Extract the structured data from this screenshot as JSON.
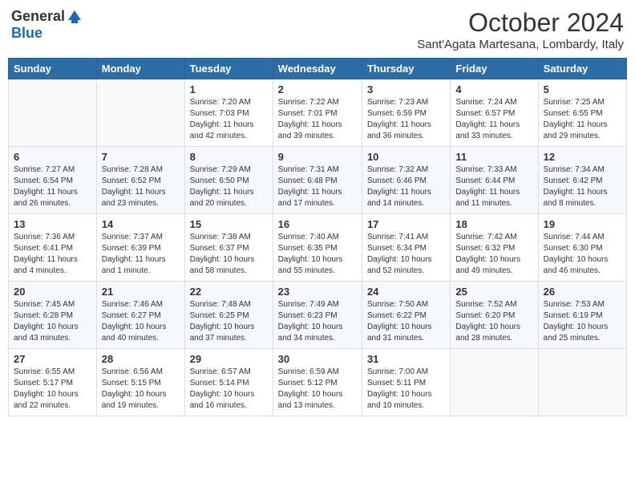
{
  "header": {
    "logo_general": "General",
    "logo_blue": "Blue",
    "month_title": "October 2024",
    "location": "Sant'Agata Martesana, Lombardy, Italy"
  },
  "days_of_week": [
    "Sunday",
    "Monday",
    "Tuesday",
    "Wednesday",
    "Thursday",
    "Friday",
    "Saturday"
  ],
  "weeks": [
    [
      {
        "day": "",
        "info": ""
      },
      {
        "day": "",
        "info": ""
      },
      {
        "day": "1",
        "info": "Sunrise: 7:20 AM\nSunset: 7:03 PM\nDaylight: 11 hours and 42 minutes."
      },
      {
        "day": "2",
        "info": "Sunrise: 7:22 AM\nSunset: 7:01 PM\nDaylight: 11 hours and 39 minutes."
      },
      {
        "day": "3",
        "info": "Sunrise: 7:23 AM\nSunset: 6:59 PM\nDaylight: 11 hours and 36 minutes."
      },
      {
        "day": "4",
        "info": "Sunrise: 7:24 AM\nSunset: 6:57 PM\nDaylight: 11 hours and 33 minutes."
      },
      {
        "day": "5",
        "info": "Sunrise: 7:25 AM\nSunset: 6:55 PM\nDaylight: 11 hours and 29 minutes."
      }
    ],
    [
      {
        "day": "6",
        "info": "Sunrise: 7:27 AM\nSunset: 6:54 PM\nDaylight: 11 hours and 26 minutes."
      },
      {
        "day": "7",
        "info": "Sunrise: 7:28 AM\nSunset: 6:52 PM\nDaylight: 11 hours and 23 minutes."
      },
      {
        "day": "8",
        "info": "Sunrise: 7:29 AM\nSunset: 6:50 PM\nDaylight: 11 hours and 20 minutes."
      },
      {
        "day": "9",
        "info": "Sunrise: 7:31 AM\nSunset: 6:48 PM\nDaylight: 11 hours and 17 minutes."
      },
      {
        "day": "10",
        "info": "Sunrise: 7:32 AM\nSunset: 6:46 PM\nDaylight: 11 hours and 14 minutes."
      },
      {
        "day": "11",
        "info": "Sunrise: 7:33 AM\nSunset: 6:44 PM\nDaylight: 11 hours and 11 minutes."
      },
      {
        "day": "12",
        "info": "Sunrise: 7:34 AM\nSunset: 6:42 PM\nDaylight: 11 hours and 8 minutes."
      }
    ],
    [
      {
        "day": "13",
        "info": "Sunrise: 7:36 AM\nSunset: 6:41 PM\nDaylight: 11 hours and 4 minutes."
      },
      {
        "day": "14",
        "info": "Sunrise: 7:37 AM\nSunset: 6:39 PM\nDaylight: 11 hours and 1 minute."
      },
      {
        "day": "15",
        "info": "Sunrise: 7:38 AM\nSunset: 6:37 PM\nDaylight: 10 hours and 58 minutes."
      },
      {
        "day": "16",
        "info": "Sunrise: 7:40 AM\nSunset: 6:35 PM\nDaylight: 10 hours and 55 minutes."
      },
      {
        "day": "17",
        "info": "Sunrise: 7:41 AM\nSunset: 6:34 PM\nDaylight: 10 hours and 52 minutes."
      },
      {
        "day": "18",
        "info": "Sunrise: 7:42 AM\nSunset: 6:32 PM\nDaylight: 10 hours and 49 minutes."
      },
      {
        "day": "19",
        "info": "Sunrise: 7:44 AM\nSunset: 6:30 PM\nDaylight: 10 hours and 46 minutes."
      }
    ],
    [
      {
        "day": "20",
        "info": "Sunrise: 7:45 AM\nSunset: 6:28 PM\nDaylight: 10 hours and 43 minutes."
      },
      {
        "day": "21",
        "info": "Sunrise: 7:46 AM\nSunset: 6:27 PM\nDaylight: 10 hours and 40 minutes."
      },
      {
        "day": "22",
        "info": "Sunrise: 7:48 AM\nSunset: 6:25 PM\nDaylight: 10 hours and 37 minutes."
      },
      {
        "day": "23",
        "info": "Sunrise: 7:49 AM\nSunset: 6:23 PM\nDaylight: 10 hours and 34 minutes."
      },
      {
        "day": "24",
        "info": "Sunrise: 7:50 AM\nSunset: 6:22 PM\nDaylight: 10 hours and 31 minutes."
      },
      {
        "day": "25",
        "info": "Sunrise: 7:52 AM\nSunset: 6:20 PM\nDaylight: 10 hours and 28 minutes."
      },
      {
        "day": "26",
        "info": "Sunrise: 7:53 AM\nSunset: 6:19 PM\nDaylight: 10 hours and 25 minutes."
      }
    ],
    [
      {
        "day": "27",
        "info": "Sunrise: 6:55 AM\nSunset: 5:17 PM\nDaylight: 10 hours and 22 minutes."
      },
      {
        "day": "28",
        "info": "Sunrise: 6:56 AM\nSunset: 5:15 PM\nDaylight: 10 hours and 19 minutes."
      },
      {
        "day": "29",
        "info": "Sunrise: 6:57 AM\nSunset: 5:14 PM\nDaylight: 10 hours and 16 minutes."
      },
      {
        "day": "30",
        "info": "Sunrise: 6:59 AM\nSunset: 5:12 PM\nDaylight: 10 hours and 13 minutes."
      },
      {
        "day": "31",
        "info": "Sunrise: 7:00 AM\nSunset: 5:11 PM\nDaylight: 10 hours and 10 minutes."
      },
      {
        "day": "",
        "info": ""
      },
      {
        "day": "",
        "info": ""
      }
    ]
  ]
}
